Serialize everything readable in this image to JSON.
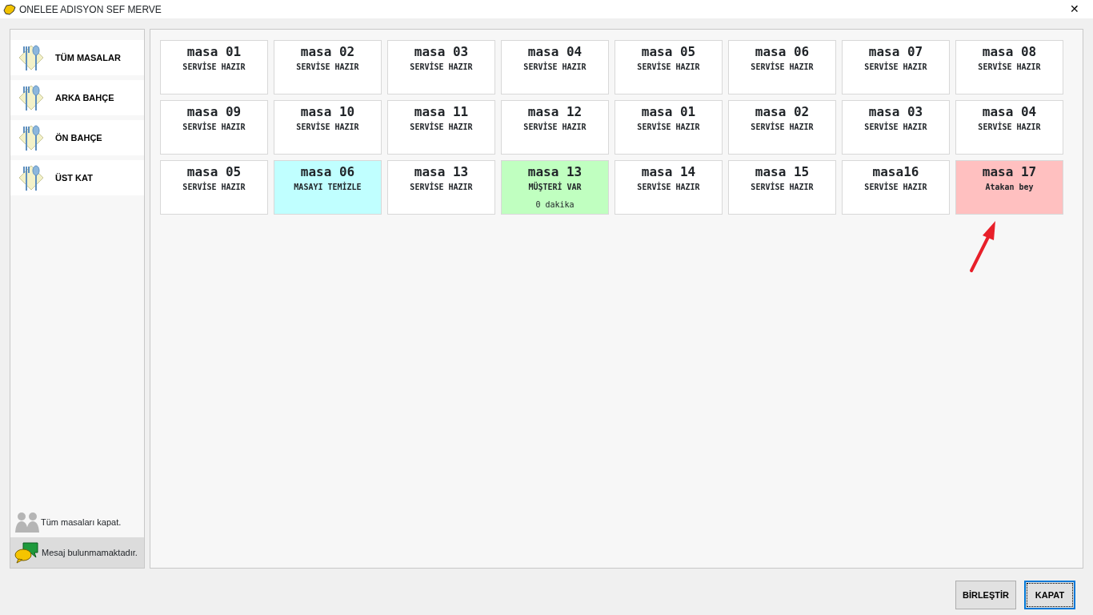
{
  "window": {
    "title": "ONELEE ADISYON SEF MERVE",
    "close": "✕"
  },
  "sections": [
    {
      "label": "TÜM MASALAR"
    },
    {
      "label": "ARKA BAHÇE"
    },
    {
      "label": "ÖN BAHÇE"
    },
    {
      "label": "ÜST KAT"
    }
  ],
  "close_all": "Tüm masaları kapat.",
  "message": "Mesaj bulunmamaktadır.",
  "tables": [
    {
      "name": "masa 01",
      "status": "SERVİSE HAZIR",
      "color": "#ffffff"
    },
    {
      "name": "masa 02",
      "status": "SERVİSE HAZIR",
      "color": "#ffffff"
    },
    {
      "name": "masa 03",
      "status": "SERVİSE HAZIR",
      "color": "#ffffff"
    },
    {
      "name": "masa 04",
      "status": "SERVİSE HAZIR",
      "color": "#ffffff"
    },
    {
      "name": "masa 05",
      "status": "SERVİSE HAZIR",
      "color": "#ffffff"
    },
    {
      "name": "masa 06",
      "status": "SERVİSE HAZIR",
      "color": "#ffffff"
    },
    {
      "name": "masa 07",
      "status": "SERVİSE HAZIR",
      "color": "#ffffff"
    },
    {
      "name": "masa 08",
      "status": "SERVİSE HAZIR",
      "color": "#ffffff"
    },
    {
      "name": "masa 09",
      "status": "SERVİSE HAZIR",
      "color": "#ffffff"
    },
    {
      "name": "masa 10",
      "status": "SERVİSE HAZIR",
      "color": "#ffffff"
    },
    {
      "name": "masa 11",
      "status": "SERVİSE HAZIR",
      "color": "#ffffff"
    },
    {
      "name": "masa 12",
      "status": "SERVİSE HAZIR",
      "color": "#ffffff"
    },
    {
      "name": "masa 01",
      "status": "SERVİSE HAZIR",
      "color": "#ffffff"
    },
    {
      "name": "masa 02",
      "status": "SERVİSE HAZIR",
      "color": "#ffffff"
    },
    {
      "name": "masa 03",
      "status": "SERVİSE HAZIR",
      "color": "#ffffff"
    },
    {
      "name": "masa 04",
      "status": "SERVİSE HAZIR",
      "color": "#ffffff"
    },
    {
      "name": "masa 05",
      "status": "SERVİSE HAZIR",
      "color": "#ffffff"
    },
    {
      "name": "masa 06",
      "status": "MASAYI TEMİZLE",
      "color": "#c0ffff"
    },
    {
      "name": "masa 13",
      "status": "SERVİSE HAZIR",
      "color": "#ffffff"
    },
    {
      "name": "masa 13",
      "status": "MÜŞTERİ VAR",
      "detail": "0 dakika",
      "color": "#c0ffc0"
    },
    {
      "name": "masa 14",
      "status": "SERVİSE HAZIR",
      "color": "#ffffff"
    },
    {
      "name": "masa 15",
      "status": "SERVİSE HAZIR",
      "color": "#ffffff"
    },
    {
      "name": "masa16",
      "status": "SERVİSE HAZIR",
      "color": "#ffffff"
    },
    {
      "name": "masa 17",
      "status": "Atakan bey",
      "color": "#ffc0c0"
    }
  ],
  "buttons": [
    {
      "label": "BİRLEŞTİR",
      "focused": false
    },
    {
      "label": "KAPAT",
      "focused": true
    }
  ]
}
